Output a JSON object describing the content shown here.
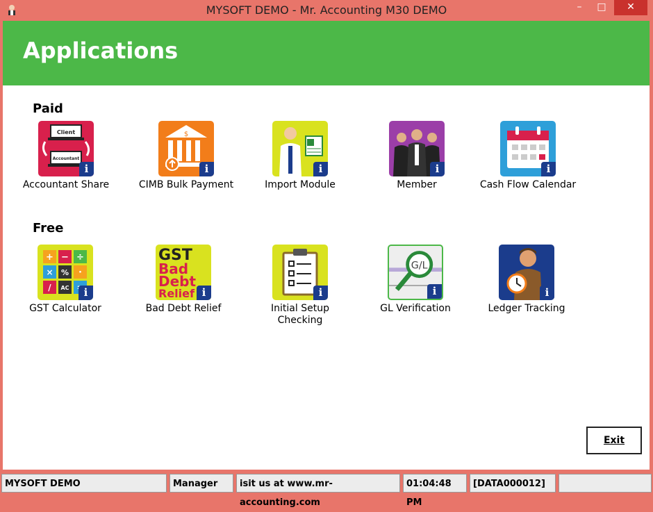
{
  "window": {
    "title": "MYSOFT DEMO - Mr. Accounting M30 DEMO",
    "controls": {
      "minimize": "–",
      "maximize": "□",
      "close": "✕"
    }
  },
  "header": {
    "title": "Applications"
  },
  "sections": {
    "paid": {
      "title": "Paid",
      "items": [
        {
          "label": "Accountant Share",
          "icon": "accountant-share-icon"
        },
        {
          "label": "CIMB Bulk Payment",
          "icon": "bank-icon"
        },
        {
          "label": "Import Module",
          "icon": "import-icon"
        },
        {
          "label": "Member",
          "icon": "member-icon"
        },
        {
          "label": "Cash Flow Calendar",
          "icon": "calendar-icon"
        }
      ]
    },
    "free": {
      "title": "Free",
      "items": [
        {
          "label": "GST Calculator",
          "icon": "calculator-icon"
        },
        {
          "label": "Bad Debt Relief",
          "icon": "bad-debt-icon"
        },
        {
          "label": "Initial Setup Checking",
          "icon": "checklist-icon"
        },
        {
          "label": "GL Verification",
          "icon": "magnifier-icon"
        },
        {
          "label": "Ledger Tracking",
          "icon": "tracking-icon"
        }
      ]
    }
  },
  "icon_text": {
    "client": "Client",
    "accountant": "Accountant",
    "dollar": "$",
    "gst": "GST",
    "bad": "Bad",
    "debt": "Debt",
    "relief": "Relief",
    "gl": "G/L",
    "info": "i"
  },
  "calculator_keys": [
    "+",
    "−",
    "÷",
    "×",
    "%",
    "·",
    "/",
    "AC",
    "="
  ],
  "exit_button": {
    "label": "Exit"
  },
  "status_bar": {
    "company": "MYSOFT DEMO",
    "user": "Manager",
    "website": "isit us at www.mr-accounting.com",
    "time": "01:04:48 PM",
    "database": "[DATA000012]"
  },
  "colors": {
    "titlebar": "#e8756a",
    "header": "#4cb848",
    "badge": "#1b3c8c",
    "close": "#c9312d"
  }
}
